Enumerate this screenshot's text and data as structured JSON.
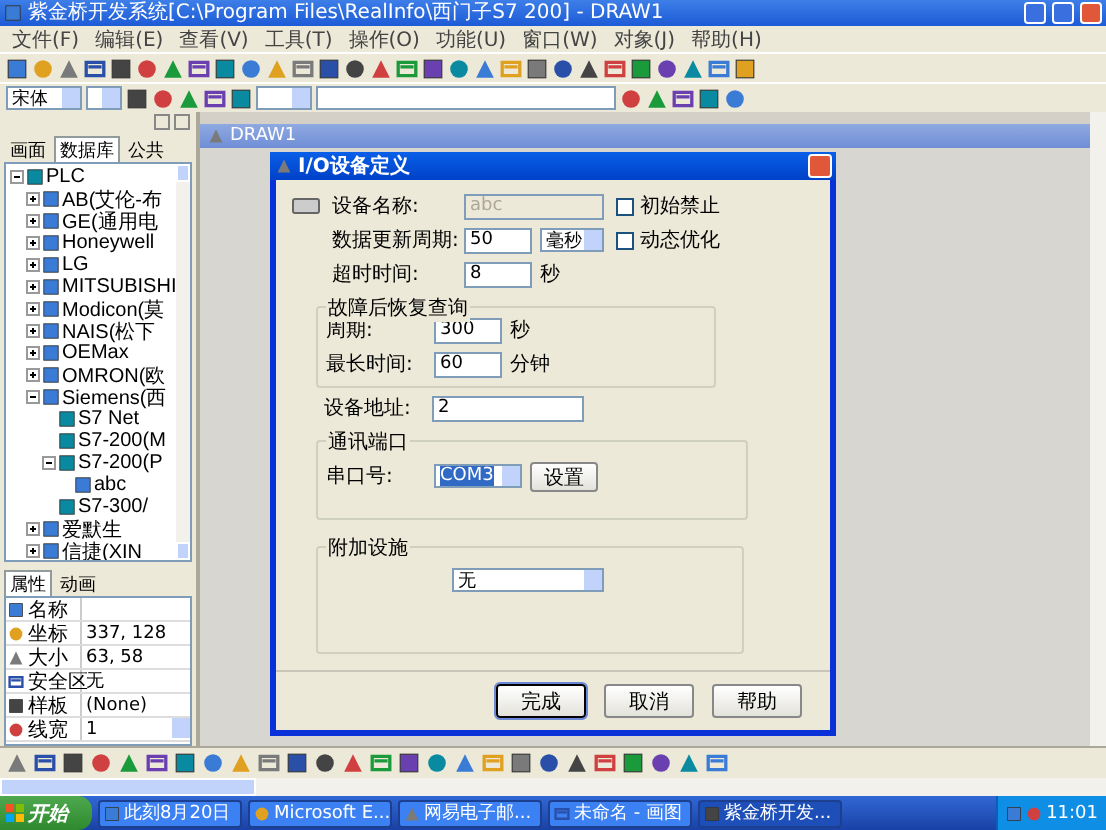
{
  "window": {
    "title": "紫金桥开发系统[C:\\Program Files\\RealInfo\\西门子S7 200] - DRAW1"
  },
  "menu": [
    "文件(F)",
    "编辑(E)",
    "查看(V)",
    "工具(T)",
    "操作(O)",
    "功能(U)",
    "窗口(W)",
    "对象(J)",
    "帮助(H)"
  ],
  "format_bar": {
    "font": "宋体"
  },
  "left_panel": {
    "tabs": [
      {
        "label": "画面",
        "selected": false
      },
      {
        "label": "数据库",
        "selected": true
      },
      {
        "label": "公共",
        "selected": false
      }
    ],
    "tree": [
      {
        "label": "PLC",
        "expanded": true,
        "children": [
          {
            "label": "AB(艾伦-布",
            "expanded": false
          },
          {
            "label": "GE(通用电",
            "expanded": false
          },
          {
            "label": "Honeywell",
            "expanded": false
          },
          {
            "label": "LG",
            "expanded": false
          },
          {
            "label": "MITSUBISHI",
            "expanded": false
          },
          {
            "label": "Modicon(莫",
            "expanded": false
          },
          {
            "label": "NAIS(松下",
            "expanded": false
          },
          {
            "label": "OEMax",
            "expanded": false
          },
          {
            "label": "OMRON(欧",
            "expanded": false
          },
          {
            "label": "Siemens(西",
            "expanded": true,
            "children": [
              {
                "label": "S7 Net"
              },
              {
                "label": "S7-200(M"
              },
              {
                "label": "S7-200(P",
                "expanded": true,
                "children": [
                  {
                    "label": "abc"
                  }
                ]
              },
              {
                "label": "S7-300/"
              }
            ]
          },
          {
            "label": "爱默生",
            "expanded": false
          },
          {
            "label": "信捷(XIN",
            "expanded": false
          }
        ]
      }
    ],
    "property_tabs": [
      {
        "label": "属性",
        "selected": true
      },
      {
        "label": "动画",
        "selected": false
      }
    ],
    "properties": [
      {
        "name": "名称",
        "kind": "text"
      },
      {
        "name": "坐标",
        "value": "337, 128",
        "kind": "text"
      },
      {
        "name": "大小",
        "value": "63, 58",
        "kind": "text"
      },
      {
        "name": "安全区",
        "value": "无",
        "kind": "text"
      },
      {
        "name": "样板",
        "value": "(None)",
        "kind": "text"
      },
      {
        "name": "线宽",
        "value": "1",
        "kind": "spin"
      }
    ]
  },
  "document": {
    "title": "DRAW1"
  },
  "dialog": {
    "title": "I/O设备定义",
    "device_name": {
      "label": "设备名称:",
      "value": "abc",
      "disabled": true
    },
    "update_period": {
      "label": "数据更新周期:",
      "value": "50",
      "unit": "毫秒"
    },
    "timeout": {
      "label": "超时时间:",
      "value": "8",
      "unit": "秒"
    },
    "checkboxes": [
      {
        "label": "初始禁止",
        "checked": false
      },
      {
        "label": "动态优化",
        "checked": false
      }
    ],
    "recovery": {
      "title": "故障后恢复查询",
      "fields": [
        {
          "label": "周期:",
          "value": "300",
          "unit": "秒"
        },
        {
          "label": "最长时间:",
          "value": "60",
          "unit": "分钟"
        }
      ]
    },
    "address": {
      "label": "设备地址:",
      "value": "2"
    },
    "comm": {
      "title": "通讯端口",
      "label": "串口号:",
      "value": "COM3",
      "button": "设置"
    },
    "extra": {
      "title": "附加设施",
      "value": "无"
    },
    "buttons": [
      {
        "label": "完成",
        "default": true
      },
      {
        "label": "取消",
        "default": false
      },
      {
        "label": "帮助",
        "default": false
      }
    ]
  },
  "taskbar": {
    "start": "开始",
    "items": [
      {
        "label": "此刻8月20日",
        "selected": false
      },
      {
        "label": "Microsoft E...",
        "selected": false
      },
      {
        "label": "网易电子邮...",
        "selected": false
      },
      {
        "label": "未命名 - 画图",
        "selected": false
      },
      {
        "label": "紫金桥开发...",
        "selected": true
      }
    ],
    "clock": "11:01"
  }
}
